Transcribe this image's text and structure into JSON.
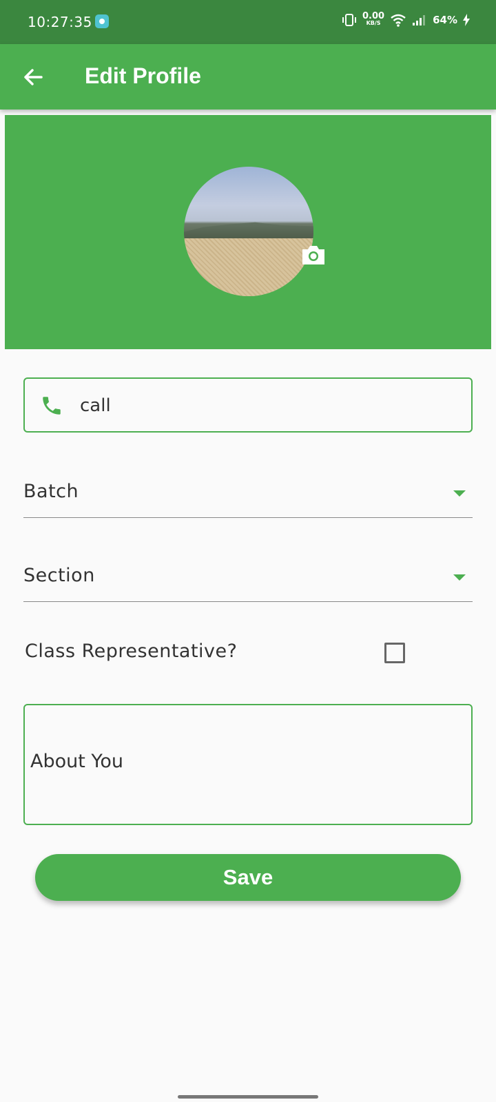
{
  "status_bar": {
    "time": "10:27:35",
    "net_speed_value": "0.00",
    "net_speed_unit": "KB/S",
    "battery": "64%"
  },
  "app_bar": {
    "title": "Edit Profile"
  },
  "profile": {
    "phone_placeholder": "call",
    "batch_label": "Batch",
    "section_label": "Section",
    "class_rep_label": "Class Representative?",
    "class_rep_checked": false,
    "about_placeholder": "About You",
    "save_label": "Save"
  },
  "colors": {
    "primary": "#4caf50",
    "status_bar": "#3b873f",
    "background": "#fafafa"
  }
}
